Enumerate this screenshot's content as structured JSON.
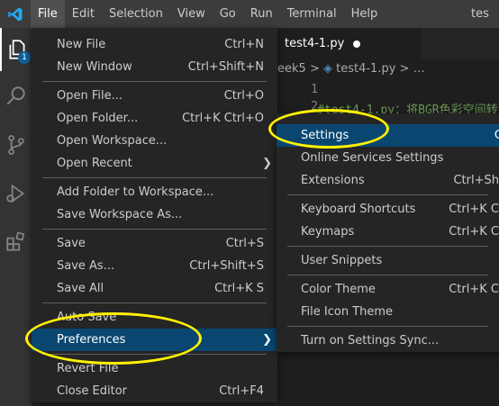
{
  "titlebar": {
    "menus": [
      "File",
      "Edit",
      "Selection",
      "View",
      "Go",
      "Run",
      "Terminal",
      "Help"
    ],
    "window_title": "tes",
    "accent_logo_color": "#23a9f2"
  },
  "activity_bar": {
    "explorer_badge": "1"
  },
  "editor": {
    "tab_label": "test4-1.py",
    "breadcrumb": {
      "folder": "eek5",
      "separator": ">",
      "file": "test4-1.py",
      "trail": "> …"
    },
    "line_numbers": [
      "1",
      "2"
    ],
    "code_lines": [
      "",
      "#test4-1.py：将BGR色彩空间转"
    ]
  },
  "file_menu": {
    "groups": [
      [
        {
          "label": "New File",
          "shortcut": "Ctrl+N"
        },
        {
          "label": "New Window",
          "shortcut": "Ctrl+Shift+N"
        }
      ],
      [
        {
          "label": "Open File...",
          "shortcut": "Ctrl+O"
        },
        {
          "label": "Open Folder...",
          "shortcut": "Ctrl+K Ctrl+O"
        },
        {
          "label": "Open Workspace...",
          "shortcut": ""
        },
        {
          "label": "Open Recent",
          "shortcut": "",
          "submenu": true
        }
      ],
      [
        {
          "label": "Add Folder to Workspace...",
          "shortcut": ""
        },
        {
          "label": "Save Workspace As...",
          "shortcut": ""
        }
      ],
      [
        {
          "label": "Save",
          "shortcut": "Ctrl+S"
        },
        {
          "label": "Save As...",
          "shortcut": "Ctrl+Shift+S"
        },
        {
          "label": "Save All",
          "shortcut": "Ctrl+K S"
        }
      ],
      [
        {
          "label": "Auto Save",
          "shortcut": ""
        },
        {
          "label": "Preferences",
          "shortcut": "",
          "submenu": true,
          "selected": true
        }
      ],
      [
        {
          "label": "Revert File",
          "shortcut": ""
        },
        {
          "label": "Close Editor",
          "shortcut": "Ctrl+F4"
        }
      ]
    ]
  },
  "preferences_menu": {
    "groups": [
      [
        {
          "label": "Settings",
          "shortcut": "C",
          "selected": true
        },
        {
          "label": "Online Services Settings",
          "shortcut": ""
        },
        {
          "label": "Extensions",
          "shortcut": "Ctrl+Sh"
        }
      ],
      [
        {
          "label": "Keyboard Shortcuts",
          "shortcut": "Ctrl+K C"
        },
        {
          "label": "Keymaps",
          "shortcut": "Ctrl+K C"
        }
      ],
      [
        {
          "label": "User Snippets",
          "shortcut": ""
        }
      ],
      [
        {
          "label": "Color Theme",
          "shortcut": "Ctrl+K C"
        },
        {
          "label": "File Icon Theme",
          "shortcut": ""
        }
      ],
      [
        {
          "label": "Turn on Settings Sync...",
          "shortcut": ""
        }
      ]
    ]
  },
  "colors": {
    "highlight_ring": "#fff200",
    "selection_bg": "#094771",
    "menu_bg": "#252526"
  }
}
